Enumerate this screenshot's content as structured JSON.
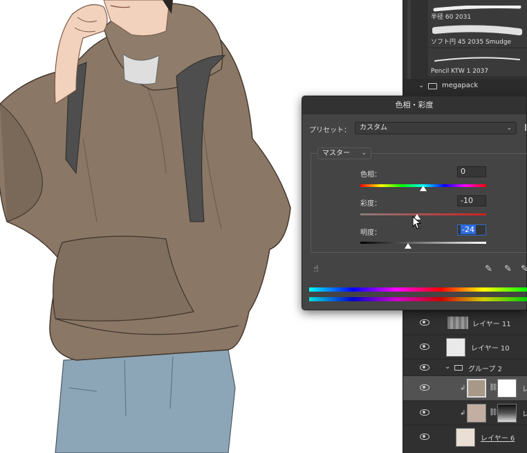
{
  "brushes": [
    {
      "label": "半径 60 2031"
    },
    {
      "label": "ソフト円 45 2035 Smudge"
    },
    {
      "label": "Pencil KTW 1 2037"
    }
  ],
  "brush_folder": {
    "label": "megapack",
    "icon": "folder-icon"
  },
  "dialog": {
    "title": "色相・彩度",
    "preset_label": "プリセット：",
    "preset_value": "カスタム",
    "channel_value": "マスター",
    "sliders": {
      "hue": {
        "label": "色相：",
        "value": "0",
        "level": 0
      },
      "saturation": {
        "label": "彩度：",
        "value": "-10",
        "level": -10
      },
      "lightness": {
        "label": "明度：",
        "value": "-24",
        "level": -24
      }
    },
    "range": {
      "min": -100,
      "max": 100
    },
    "tools": [
      "hand-target-icon",
      "eyedropper-icon",
      "eyedropper-plus-icon",
      "eyedropper-minus-icon"
    ]
  },
  "layers": [
    {
      "name": "レイヤー 11",
      "type": "layer"
    },
    {
      "name": "レイヤー 10",
      "type": "layer"
    },
    {
      "name": "グループ 2",
      "type": "group"
    },
    {
      "name": "レ",
      "type": "adjustment",
      "selected": true
    },
    {
      "name": "レ",
      "type": "adjustment"
    },
    {
      "name": "レイヤー 6",
      "type": "layer"
    }
  ],
  "colors": {
    "hoodie": "#8a7766",
    "jeans": "#8ca5b7",
    "skin": "#f2d2bd",
    "panel_bg": "#303030",
    "dialog_bg": "#444444",
    "accent": "#2e6ce0"
  }
}
